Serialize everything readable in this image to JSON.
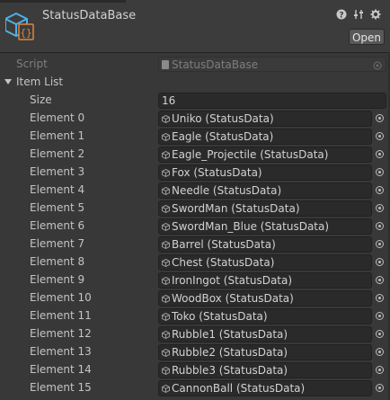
{
  "header": {
    "title": "StatusDataBase",
    "open_label": "Open",
    "icons": [
      "help-icon",
      "preset-icon",
      "settings-icon"
    ]
  },
  "script": {
    "label": "Script",
    "value": "StatusDataBase"
  },
  "item_list": {
    "label": "Item List",
    "size_label": "Size",
    "size_value": "16",
    "elements": [
      {
        "label": "Element 0",
        "value": "Uniko (StatusData)"
      },
      {
        "label": "Element 1",
        "value": "Eagle (StatusData)"
      },
      {
        "label": "Element 2",
        "value": "Eagle_Projectile (StatusData)"
      },
      {
        "label": "Element 3",
        "value": "Fox (StatusData)"
      },
      {
        "label": "Element 4",
        "value": "Needle (StatusData)"
      },
      {
        "label": "Element 5",
        "value": "SwordMan (StatusData)"
      },
      {
        "label": "Element 6",
        "value": "SwordMan_Blue (StatusData)"
      },
      {
        "label": "Element 7",
        "value": "Barrel (StatusData)"
      },
      {
        "label": "Element 8",
        "value": "Chest (StatusData)"
      },
      {
        "label": "Element 9",
        "value": "IronIngot (StatusData)"
      },
      {
        "label": "Element 10",
        "value": "WoodBox (StatusData)"
      },
      {
        "label": "Element 11",
        "value": "Toko (StatusData)"
      },
      {
        "label": "Element 12",
        "value": "Rubble1 (StatusData)"
      },
      {
        "label": "Element 13",
        "value": "Rubble2 (StatusData)"
      },
      {
        "label": "Element 14",
        "value": "Rubble3 (StatusData)"
      },
      {
        "label": "Element 15",
        "value": "CannonBall (StatusData)"
      }
    ]
  },
  "colors": {
    "background": "#383838",
    "field": "#2a2a2a",
    "accent_icon": "#4fb0e6",
    "script_icon_braces": "#e0853a"
  }
}
